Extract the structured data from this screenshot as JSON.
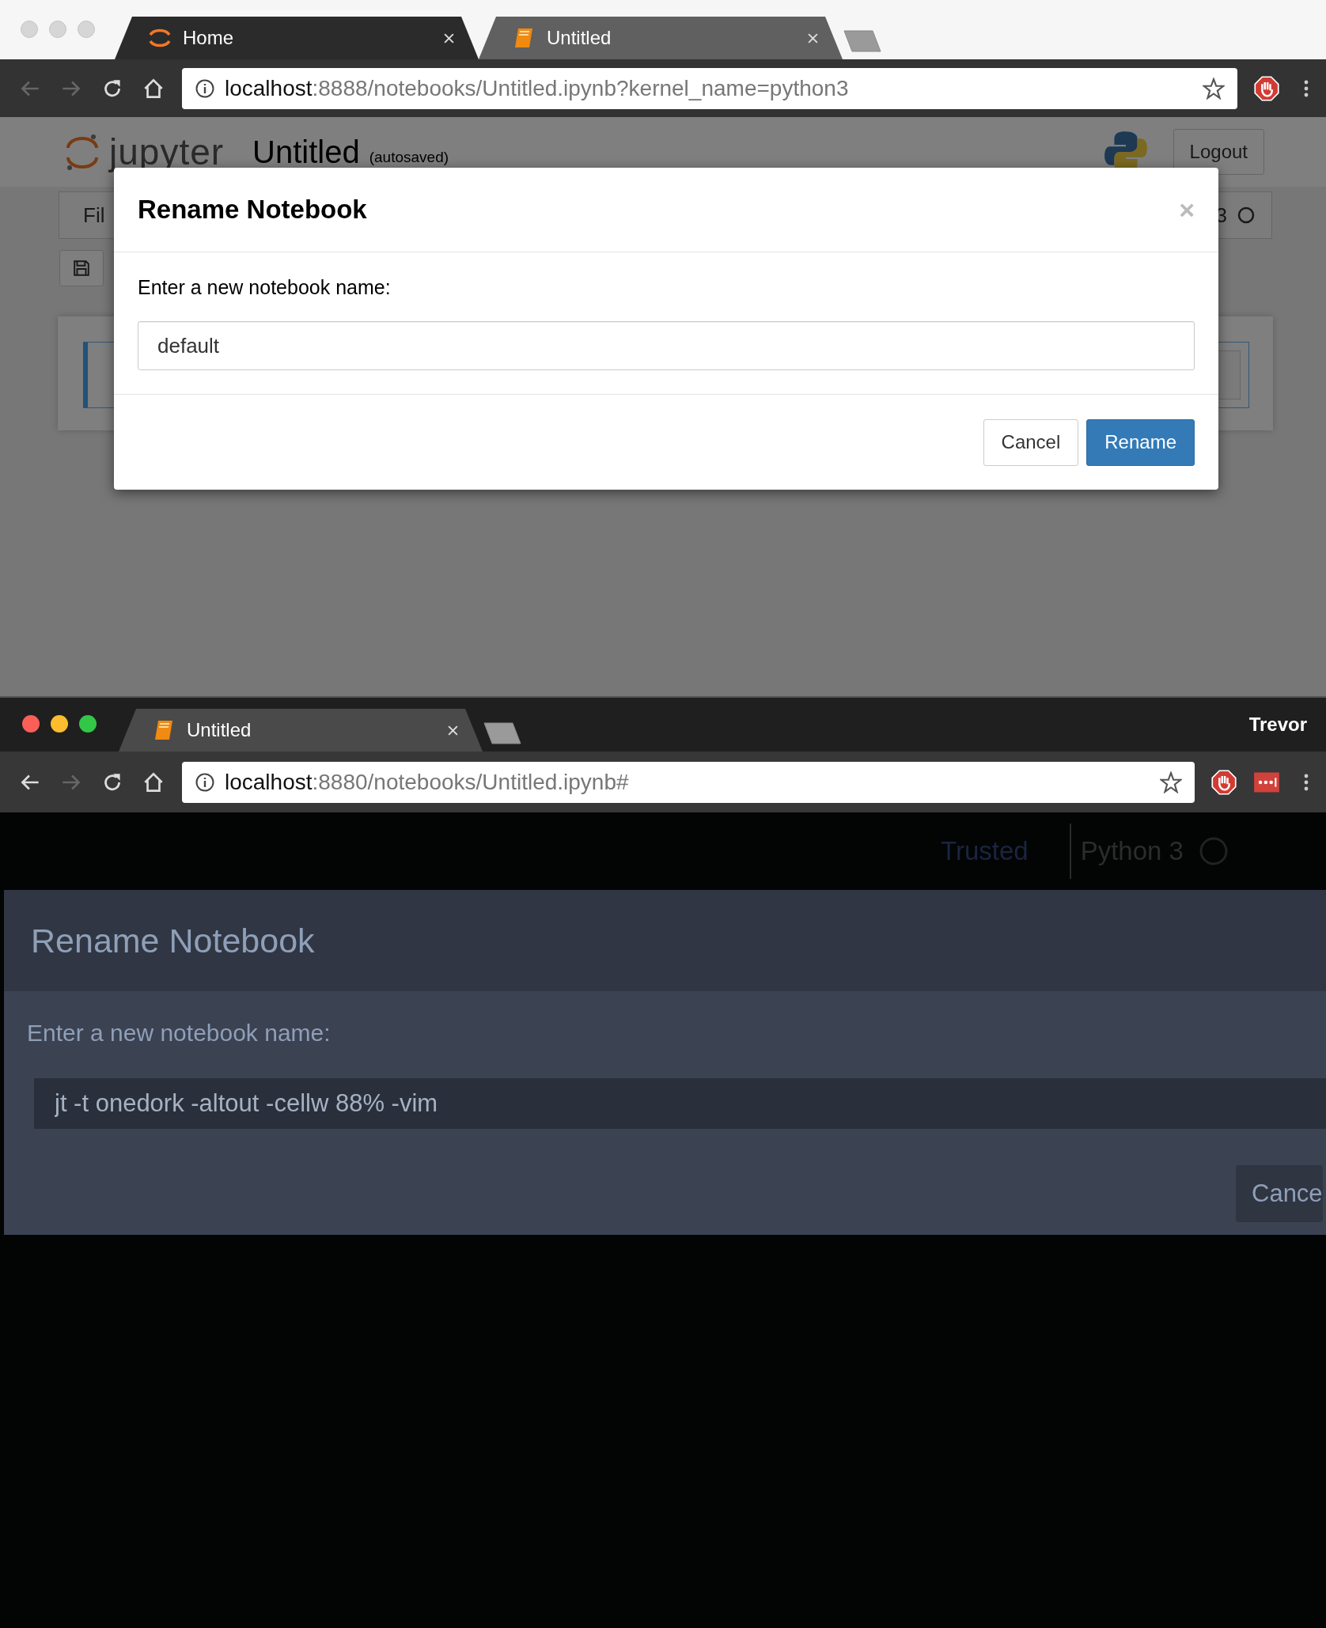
{
  "windows": [
    {
      "kind": "light",
      "active": false,
      "tabs": [
        {
          "label": "Home",
          "selected": false,
          "kind": "jupyter"
        },
        {
          "label": "Untitled",
          "selected": true,
          "kind": "notebook"
        }
      ],
      "address": {
        "host": "localhost",
        "rest": ":8888/notebooks/Untitled.ipynb?kernel_name=python3"
      },
      "extensions": [
        {
          "kind": "block"
        }
      ],
      "header": {
        "logo_text": "jupyter",
        "title": "Untitled",
        "autosave": "(autosaved)",
        "logout": "Logout"
      },
      "menubar": {
        "first_item": "Fil",
        "kernel_fragment": "3"
      },
      "dialog": {
        "title": "Rename Notebook",
        "close": "×",
        "prompt": "Enter a new notebook name:",
        "value": "default",
        "buttons": [
          {
            "label": "Cancel",
            "primary": false
          },
          {
            "label": "Rename",
            "primary": true
          }
        ]
      }
    },
    {
      "kind": "dark",
      "active": true,
      "profile": "Trevor",
      "tabs": [
        {
          "label": "Untitled",
          "selected": true,
          "kind": "notebook"
        }
      ],
      "address": {
        "host": "localhost",
        "rest": ":8880/notebooks/Untitled.ipynb#"
      },
      "extensions": [
        {
          "kind": "block"
        },
        {
          "kind": "dots"
        }
      ],
      "header": {
        "trusted": "Trusted",
        "kernel": "Python 3"
      },
      "dialog": {
        "title": "Rename Notebook",
        "prompt": "Enter a new notebook name:",
        "value": "jt -t onedork -altout -cellw 88% -vim",
        "buttons": [
          {
            "label": "Cance",
            "primary": false
          }
        ]
      }
    }
  ]
}
